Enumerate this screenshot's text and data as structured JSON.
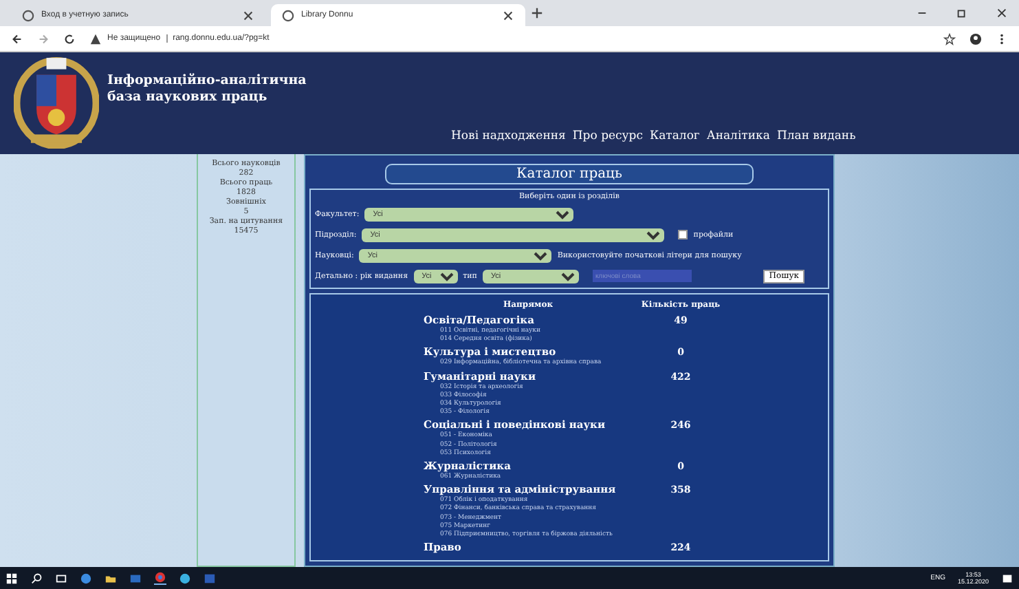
{
  "browser": {
    "tabs": [
      {
        "title": "Вход в учетную запись",
        "selected": false
      },
      {
        "title": "Library Donnu",
        "selected": true
      }
    ],
    "address": {
      "security": "Не защищено",
      "url": "rang.donnu.edu.ua/?pg=kt"
    }
  },
  "site": {
    "title_lines": [
      "Інформаційно-аналітична",
      "база наукових праць"
    ],
    "nav": [
      "Нові надходження",
      "Про ресурс",
      "Каталог",
      "Аналітика",
      "План видань"
    ]
  },
  "stats": [
    {
      "label": "Всього науковців",
      "value": "282"
    },
    {
      "label": "Всього праць",
      "value": "1828"
    },
    {
      "label": "Зовнішніх",
      "value": "5"
    },
    {
      "label": "Зап. на цитування",
      "value": "15475"
    }
  ],
  "catalog": {
    "title": "Каталог праць",
    "subtitle": "Виберіть один із розділів",
    "faculty": {
      "label": "Факультет:",
      "value": "Усі"
    },
    "department": {
      "label": "Підрозділ:",
      "value": "Усі"
    },
    "profiles": {
      "label": "профайли",
      "checked": false
    },
    "scientists": {
      "label": "Науковці:",
      "value": "Усі"
    },
    "hint": "Використовуйте початкові літери для пошуку",
    "detail_label": "Детально : рік видання",
    "year": "Усі",
    "type_label": "тип",
    "type": "Усі",
    "search_placeholder": "ключові слова",
    "search_button": "Пошук"
  },
  "table": {
    "columns": [
      "Напрямок",
      "Кількість праць"
    ],
    "rows": [
      {
        "name": "Освіта/Педагогіка",
        "count": "49",
        "subs": [
          "011 Освітні, педагогічні науки",
          "014 Середня освіта (фізика)"
        ]
      },
      {
        "name": "Культура і мистецтво",
        "count": "0",
        "subs": [
          "029 Інформаційна, бібліотечна та архівна справа"
        ]
      },
      {
        "name": "Гуманітарні науки",
        "count": "422",
        "subs": [
          "032 Історія та археологія",
          "033 Філософія",
          "034 Культурологія",
          "035 - Філологія"
        ]
      },
      {
        "name": "Соціальні і поведінкові науки",
        "count": "246",
        "subs": [
          "051 - Економіка",
          "052 - Політологія",
          "053 Психологія"
        ]
      },
      {
        "name": "Журналістика",
        "count": "0",
        "subs": [
          "061 Журналістика"
        ]
      },
      {
        "name": "Управління та адміністрування",
        "count": "358",
        "subs": [
          "071 Облік і оподаткування",
          "072 Фінанси, банківська справа та страхування",
          "073 - Менеджмент",
          "075 Маркетинг",
          "076 Підприємництво, торгівля та біржова діяльність"
        ]
      },
      {
        "name": "Право",
        "count": "224",
        "subs": []
      }
    ]
  },
  "taskbar": {
    "language": "ENG",
    "time": "13:53",
    "date": "15.12.2020"
  }
}
